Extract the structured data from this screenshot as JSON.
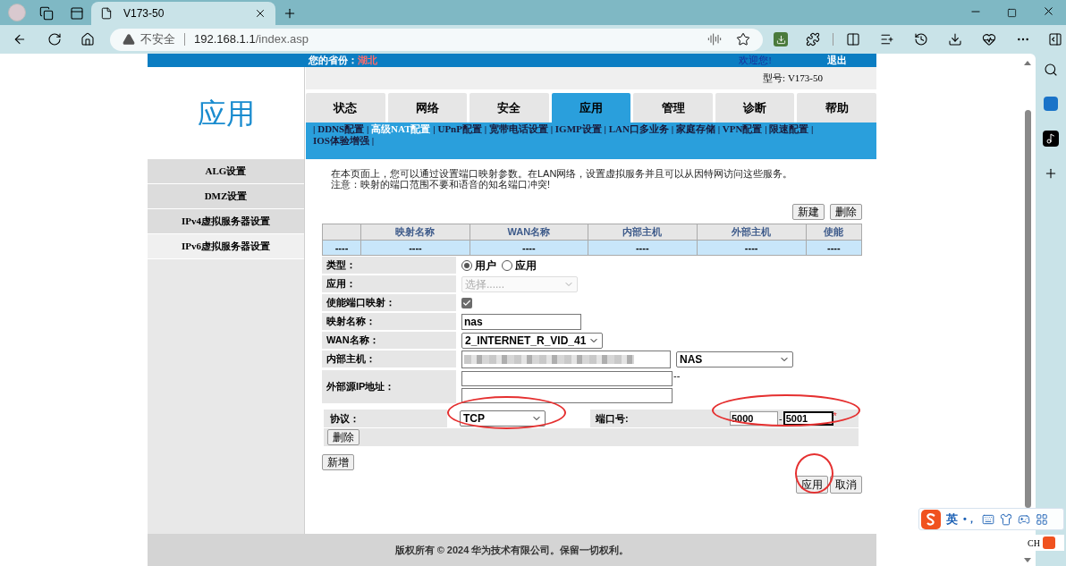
{
  "browser": {
    "tab_title": "V173-50",
    "security_label": "不安全",
    "url_host": "192.168.1.1",
    "url_path": "/index.asp"
  },
  "header": {
    "province_label": "您的省份：",
    "province": "湖北",
    "welcome": "欢迎您!",
    "logout": "退出",
    "model": "型号: V173-50"
  },
  "section_title": "应用",
  "side_menu": [
    {
      "label": "ALG设置",
      "selected": false
    },
    {
      "label": "DMZ设置",
      "selected": false
    },
    {
      "label": "IPv4虚拟服务器设置",
      "selected": false
    },
    {
      "label": "IPv6虚拟服务器设置",
      "selected": true
    }
  ],
  "tabs": [
    {
      "label": "状态",
      "selected": false
    },
    {
      "label": "网络",
      "selected": false
    },
    {
      "label": "安全",
      "selected": false
    },
    {
      "label": "应用",
      "selected": true
    },
    {
      "label": "管理",
      "selected": false
    },
    {
      "label": "诊断",
      "selected": false
    },
    {
      "label": "帮助",
      "selected": false
    }
  ],
  "sub_nav": {
    "separator": "|",
    "items": [
      {
        "label": "DDNS配置",
        "selected": false
      },
      {
        "label": "高级NAT配置",
        "selected": true
      },
      {
        "label": "UPnP配置",
        "selected": false
      },
      {
        "label": "宽带电话设置",
        "selected": false
      },
      {
        "label": "IGMP设置",
        "selected": false
      },
      {
        "label": "LAN口多业务",
        "selected": false
      },
      {
        "label": "家庭存储",
        "selected": false
      },
      {
        "label": "VPN配置",
        "selected": false
      },
      {
        "label": "限速配置",
        "selected": false
      },
      {
        "label": "IOS体验增强",
        "selected": false
      }
    ]
  },
  "intro": [
    "在本页面上，您可以通过设置端口映射参数。在LAN网络，设置虚拟服务并且可以从因特网访问这些服务。",
    "注意：映射的端口范围不要和语音的知名端口冲突!"
  ],
  "table_buttons": [
    "新建",
    "删除"
  ],
  "table": {
    "columns": [
      "",
      "映射名称",
      "WAN名称",
      "内部主机",
      "外部主机",
      "使能"
    ],
    "rows": [
      [
        "----",
        "----",
        "----",
        "----",
        "----",
        "----"
      ]
    ]
  },
  "form": [
    {
      "kind": "radio",
      "label": "类型：",
      "options": [
        {
          "label": "用户",
          "selected": true
        },
        {
          "label": "应用",
          "selected": false
        }
      ]
    },
    {
      "kind": "select",
      "label": "应用：",
      "value": "选择......",
      "disabled": true
    },
    {
      "kind": "checkbox",
      "label": "使能端口映射：",
      "checked": true
    },
    {
      "kind": "text",
      "label": "映射名称：",
      "value": "nas"
    },
    {
      "kind": "select",
      "label": "WAN名称：",
      "value": "2_INTERNET_R_VID_41",
      "disabled": false
    },
    {
      "kind": "host",
      "label": "内部主机：",
      "redacted": true,
      "device": "NAS"
    },
    {
      "kind": "range",
      "label": "外部源IP地址：",
      "separator": "--"
    }
  ],
  "protocol": {
    "label": "协议：",
    "value": "TCP",
    "port_label": "端口号:",
    "port_start": "5000",
    "separator": "-",
    "port_end": "5001",
    "required_mark": "*",
    "delete_button": "删除"
  },
  "add_button": "新增",
  "actions": [
    "应用",
    "取消"
  ],
  "footer": "版权所有 © 2024 华为技术有限公司。保留一切权利。",
  "ime": {
    "language": "英",
    "punctuation": "•，",
    "language_code": "CH"
  }
}
